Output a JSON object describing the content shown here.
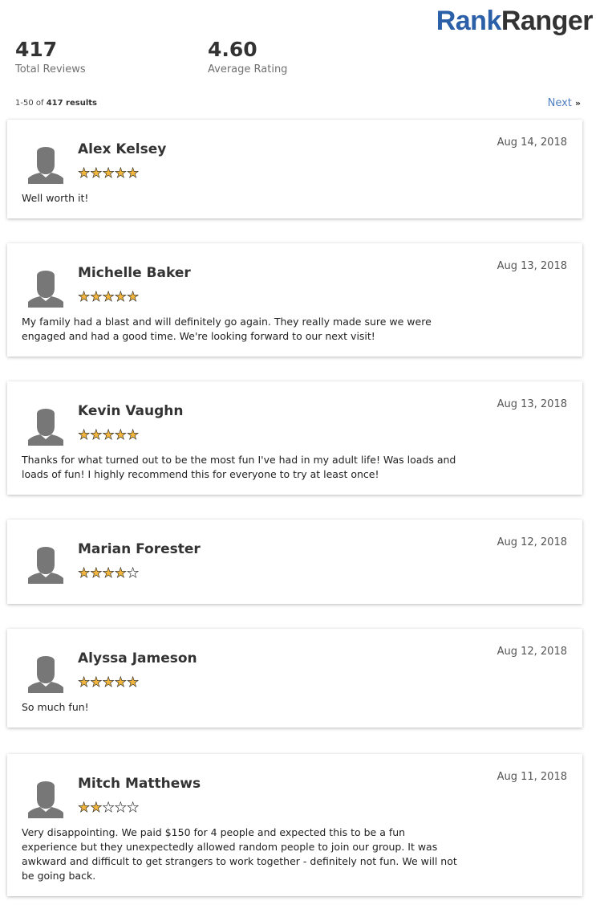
{
  "brand": {
    "part1": "Rank",
    "part2": "Ranger"
  },
  "stats": {
    "total_reviews": "417",
    "total_reviews_label": "Total Reviews",
    "average_rating": "4.60",
    "average_rating_label": "Average Rating"
  },
  "pagination": {
    "range": "1-50 of",
    "count": "417 results",
    "next_label": "Next",
    "next_icon": "»"
  },
  "reviews": [
    {
      "name": "Alex Kelsey",
      "date": "Aug 14, 2018",
      "rating": 5,
      "stars": "★★★★★",
      "text": "Well worth it!"
    },
    {
      "name": "Michelle Baker",
      "date": "Aug 13, 2018",
      "rating": 5,
      "stars": "★★★★★",
      "text": "My family had a blast and will definitely go again. They really made sure we were engaged and had a good time. We're looking forward to our next visit!"
    },
    {
      "name": "Kevin Vaughn",
      "date": "Aug 13, 2018",
      "rating": 5,
      "stars": "★★★★★",
      "text": "Thanks for what turned out to be the most fun I've had in my adult life! Was loads and loads of fun! I highly recommend this for everyone to try at least once!"
    },
    {
      "name": "Marian Forester",
      "date": "Aug 12, 2018",
      "rating": 4,
      "stars": "★★★★☆",
      "text": ""
    },
    {
      "name": "Alyssa Jameson",
      "date": "Aug 12, 2018",
      "rating": 5,
      "stars": "★★★★★",
      "text": "So much fun!"
    },
    {
      "name": "Mitch Matthews",
      "date": "Aug 11, 2018",
      "rating": 2,
      "stars": "★★☆☆☆",
      "text": "Very disappointing. We paid $150 for 4 people and expected this to be a fun experience but they unexpectedly allowed random people to join our group. It was awkward and difficult to get strangers to work together - definitely not fun. We will not be going back."
    }
  ]
}
